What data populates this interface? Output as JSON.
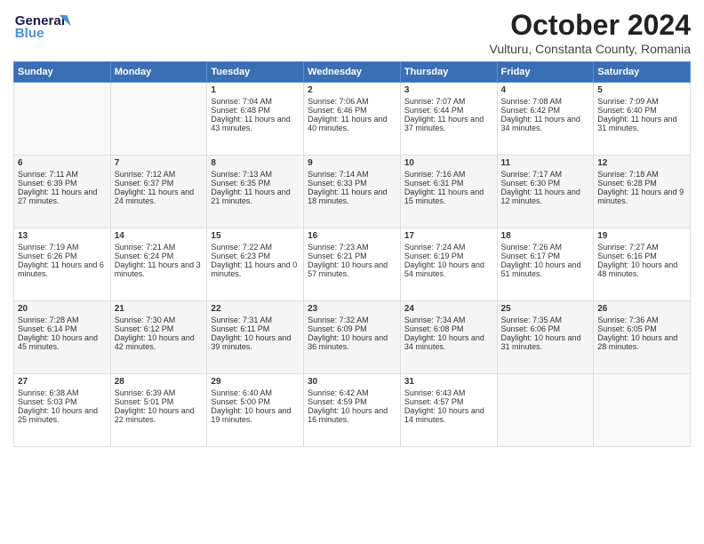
{
  "header": {
    "logo_line1": "General",
    "logo_line2": "Blue",
    "month": "October 2024",
    "location": "Vulturu, Constanta County, Romania"
  },
  "days_of_week": [
    "Sunday",
    "Monday",
    "Tuesday",
    "Wednesday",
    "Thursday",
    "Friday",
    "Saturday"
  ],
  "weeks": [
    [
      {
        "day": "",
        "content": ""
      },
      {
        "day": "",
        "content": ""
      },
      {
        "day": "1",
        "content": "Sunrise: 7:04 AM\nSunset: 6:48 PM\nDaylight: 11 hours and 43 minutes."
      },
      {
        "day": "2",
        "content": "Sunrise: 7:06 AM\nSunset: 6:46 PM\nDaylight: 11 hours and 40 minutes."
      },
      {
        "day": "3",
        "content": "Sunrise: 7:07 AM\nSunset: 6:44 PM\nDaylight: 11 hours and 37 minutes."
      },
      {
        "day": "4",
        "content": "Sunrise: 7:08 AM\nSunset: 6:42 PM\nDaylight: 11 hours and 34 minutes."
      },
      {
        "day": "5",
        "content": "Sunrise: 7:09 AM\nSunset: 6:40 PM\nDaylight: 11 hours and 31 minutes."
      }
    ],
    [
      {
        "day": "6",
        "content": "Sunrise: 7:11 AM\nSunset: 6:39 PM\nDaylight: 11 hours and 27 minutes."
      },
      {
        "day": "7",
        "content": "Sunrise: 7:12 AM\nSunset: 6:37 PM\nDaylight: 11 hours and 24 minutes."
      },
      {
        "day": "8",
        "content": "Sunrise: 7:13 AM\nSunset: 6:35 PM\nDaylight: 11 hours and 21 minutes."
      },
      {
        "day": "9",
        "content": "Sunrise: 7:14 AM\nSunset: 6:33 PM\nDaylight: 11 hours and 18 minutes."
      },
      {
        "day": "10",
        "content": "Sunrise: 7:16 AM\nSunset: 6:31 PM\nDaylight: 11 hours and 15 minutes."
      },
      {
        "day": "11",
        "content": "Sunrise: 7:17 AM\nSunset: 6:30 PM\nDaylight: 11 hours and 12 minutes."
      },
      {
        "day": "12",
        "content": "Sunrise: 7:18 AM\nSunset: 6:28 PM\nDaylight: 11 hours and 9 minutes."
      }
    ],
    [
      {
        "day": "13",
        "content": "Sunrise: 7:19 AM\nSunset: 6:26 PM\nDaylight: 11 hours and 6 minutes."
      },
      {
        "day": "14",
        "content": "Sunrise: 7:21 AM\nSunset: 6:24 PM\nDaylight: 11 hours and 3 minutes."
      },
      {
        "day": "15",
        "content": "Sunrise: 7:22 AM\nSunset: 6:23 PM\nDaylight: 11 hours and 0 minutes."
      },
      {
        "day": "16",
        "content": "Sunrise: 7:23 AM\nSunset: 6:21 PM\nDaylight: 10 hours and 57 minutes."
      },
      {
        "day": "17",
        "content": "Sunrise: 7:24 AM\nSunset: 6:19 PM\nDaylight: 10 hours and 54 minutes."
      },
      {
        "day": "18",
        "content": "Sunrise: 7:26 AM\nSunset: 6:17 PM\nDaylight: 10 hours and 51 minutes."
      },
      {
        "day": "19",
        "content": "Sunrise: 7:27 AM\nSunset: 6:16 PM\nDaylight: 10 hours and 48 minutes."
      }
    ],
    [
      {
        "day": "20",
        "content": "Sunrise: 7:28 AM\nSunset: 6:14 PM\nDaylight: 10 hours and 45 minutes."
      },
      {
        "day": "21",
        "content": "Sunrise: 7:30 AM\nSunset: 6:12 PM\nDaylight: 10 hours and 42 minutes."
      },
      {
        "day": "22",
        "content": "Sunrise: 7:31 AM\nSunset: 6:11 PM\nDaylight: 10 hours and 39 minutes."
      },
      {
        "day": "23",
        "content": "Sunrise: 7:32 AM\nSunset: 6:09 PM\nDaylight: 10 hours and 36 minutes."
      },
      {
        "day": "24",
        "content": "Sunrise: 7:34 AM\nSunset: 6:08 PM\nDaylight: 10 hours and 34 minutes."
      },
      {
        "day": "25",
        "content": "Sunrise: 7:35 AM\nSunset: 6:06 PM\nDaylight: 10 hours and 31 minutes."
      },
      {
        "day": "26",
        "content": "Sunrise: 7:36 AM\nSunset: 6:05 PM\nDaylight: 10 hours and 28 minutes."
      }
    ],
    [
      {
        "day": "27",
        "content": "Sunrise: 6:38 AM\nSunset: 5:03 PM\nDaylight: 10 hours and 25 minutes."
      },
      {
        "day": "28",
        "content": "Sunrise: 6:39 AM\nSunset: 5:01 PM\nDaylight: 10 hours and 22 minutes."
      },
      {
        "day": "29",
        "content": "Sunrise: 6:40 AM\nSunset: 5:00 PM\nDaylight: 10 hours and 19 minutes."
      },
      {
        "day": "30",
        "content": "Sunrise: 6:42 AM\nSunset: 4:59 PM\nDaylight: 10 hours and 16 minutes."
      },
      {
        "day": "31",
        "content": "Sunrise: 6:43 AM\nSunset: 4:57 PM\nDaylight: 10 hours and 14 minutes."
      },
      {
        "day": "",
        "content": ""
      },
      {
        "day": "",
        "content": ""
      }
    ]
  ]
}
